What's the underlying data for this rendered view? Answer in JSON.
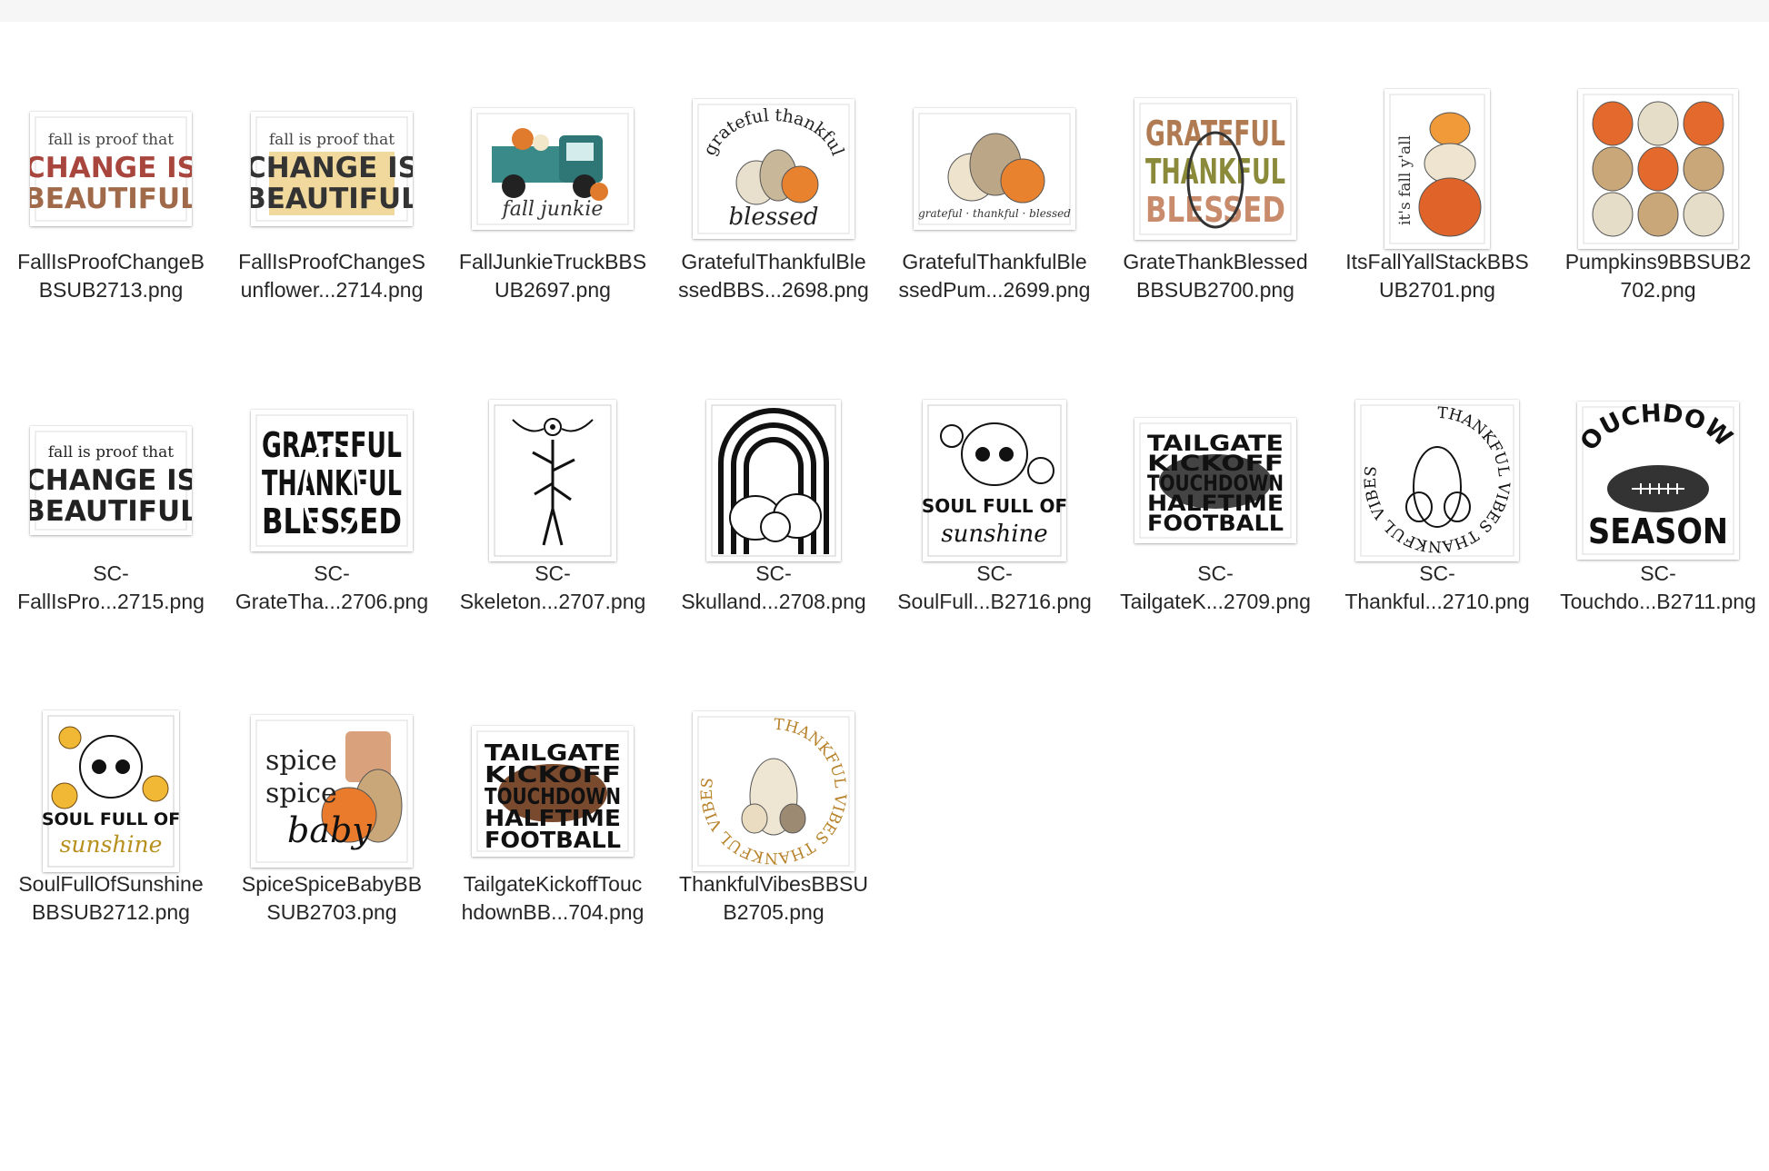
{
  "files": [
    {
      "name": "FallIsProofChangeB\nBSUB2713.png",
      "art": {
        "top": "fall is proof that",
        "l1": "CHANGE IS",
        "l2": "BEAUTIFUL"
      }
    },
    {
      "name": "FallIsProofChangeS\nunflower...2714.png",
      "art": {
        "top": "fall is proof that",
        "l1": "CHANGE IS",
        "l2": "BEAUTIFUL"
      }
    },
    {
      "name": "FallJunkieTruckBBS\nUB2697.png",
      "art": {
        "caption": "fall junkie"
      }
    },
    {
      "name": "GratefulThankfulBle\nssedBBS...2698.png",
      "art": {
        "arc": "grateful thankful",
        "bottom": "blessed"
      }
    },
    {
      "name": "GratefulThankfulBle\nssedPum...2699.png",
      "art": {
        "caption": "grateful · thankful · blessed"
      }
    },
    {
      "name": "GrateThankBlessed\nBBSUB2700.png",
      "art": {
        "l1": "GRATEFUL",
        "l2": "THANKFUL",
        "l3": "BLESSED"
      }
    },
    {
      "name": "ItsFallYallStackBBS\nUB2701.png",
      "art": {
        "side": "it's fall y'all"
      }
    },
    {
      "name": "Pumpkins9BBSUB2\n702.png",
      "art": {}
    },
    {
      "name": "SC-\nFallIsPro...2715.png",
      "art": {
        "top": "fall is proof that",
        "l1": "CHANGE IS",
        "l2": "BEAUTIFUL"
      }
    },
    {
      "name": "SC-\nGrateTha...2706.png",
      "art": {
        "l1": "GRATEFUL",
        "l2": "THANKFUL",
        "l3": "BLESSED"
      }
    },
    {
      "name": "SC-\nSkeleton...2707.png",
      "art": {}
    },
    {
      "name": "SC-\nSkulland...2708.png",
      "art": {}
    },
    {
      "name": "SC-\nSoulFull...B2716.png",
      "art": {
        "l1": "SOUL FULL OF",
        "l2": "sunshine"
      }
    },
    {
      "name": "SC-\nTailgateK...2709.png",
      "art": {
        "l1": "TAILGATE",
        "l2": "KICKOFF",
        "l3": "TOUCHDOWN",
        "l4": "HALFTIME",
        "l5": "FOOTBALL"
      }
    },
    {
      "name": "SC-\nThankful...2710.png",
      "art": {
        "arc": "THANKFUL VIBES THANKFUL VIBES"
      }
    },
    {
      "name": "SC-\nTouchdo...B2711.png",
      "art": {
        "l1": "TOUCHDOWN",
        "l2": "SEASON"
      }
    },
    {
      "name": "SoulFullOfSunshine\nBBSUB2712.png",
      "art": {
        "l1": "SOUL FULL OF",
        "l2": "sunshine"
      }
    },
    {
      "name": "SpiceSpiceBabyBB\nSUB2703.png",
      "art": {
        "l1": "spice",
        "l2": "spice",
        "l3": "baby"
      }
    },
    {
      "name": "TailgateKickoffTouc\nhdownBB...704.png",
      "art": {
        "l1": "TAILGATE",
        "l2": "KICKOFF",
        "l3": "TOUCHDOWN",
        "l4": "HALFTIME",
        "l5": "FOOTBALL"
      }
    },
    {
      "name": "ThankfulVibesBBSU\nB2705.png",
      "art": {
        "arc": "THANKFUL VIBES THANKFUL VIBES"
      }
    }
  ]
}
